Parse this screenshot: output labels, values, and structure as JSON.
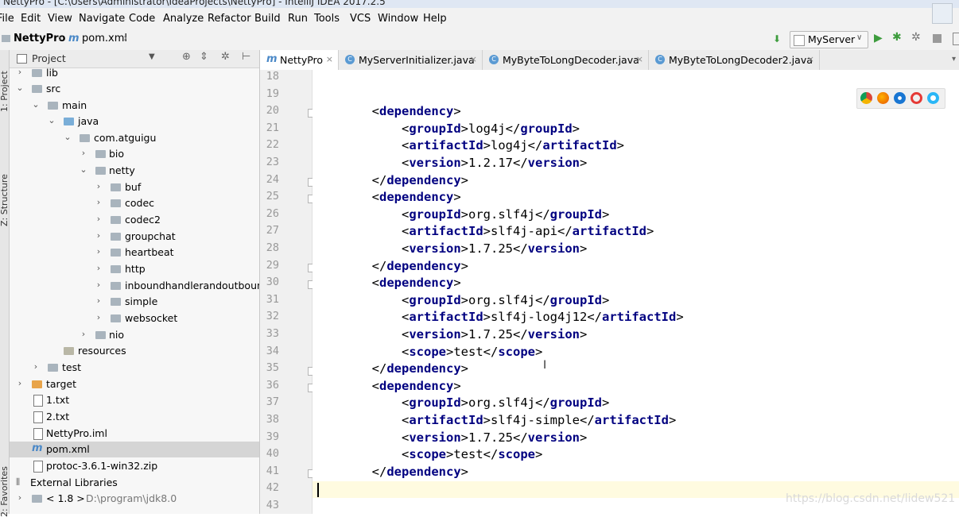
{
  "window_title": "NettyPro - [C:\\Users\\Administrator\\IdeaProjects\\NettyPro] - IntelliJ IDEA 2017.2.5",
  "menu": [
    "File",
    "Edit",
    "View",
    "Navigate",
    "Code",
    "Analyze",
    "Refactor",
    "Build",
    "Run",
    "Tools",
    "VCS",
    "Window",
    "Help"
  ],
  "breadcrumb": {
    "project": "NettyPro",
    "file": "pom.xml"
  },
  "run_config": "MyServer",
  "side_tabs": {
    "project": "1: Project",
    "structure": "Z: Structure",
    "favorites": "2: Favorites"
  },
  "project_panel": {
    "title": "Project",
    "tree": [
      {
        "label": "lib",
        "type": "folder"
      },
      {
        "label": "src",
        "type": "folder"
      },
      {
        "label": "main",
        "type": "folder"
      },
      {
        "label": "java",
        "type": "source-folder"
      },
      {
        "label": "com.atguigu",
        "type": "package"
      },
      {
        "label": "bio",
        "type": "package"
      },
      {
        "label": "netty",
        "type": "package"
      },
      {
        "label": "buf",
        "type": "package"
      },
      {
        "label": "codec",
        "type": "package"
      },
      {
        "label": "codec2",
        "type": "package"
      },
      {
        "label": "groupchat",
        "type": "package"
      },
      {
        "label": "heartbeat",
        "type": "package"
      },
      {
        "label": "http",
        "type": "package"
      },
      {
        "label": "inboundhandlerandoutbound",
        "type": "package"
      },
      {
        "label": "simple",
        "type": "package"
      },
      {
        "label": "websocket",
        "type": "package"
      },
      {
        "label": "nio",
        "type": "package"
      },
      {
        "label": "resources",
        "type": "resources-folder"
      },
      {
        "label": "test",
        "type": "folder"
      },
      {
        "label": "target",
        "type": "excluded-folder"
      },
      {
        "label": "1.txt",
        "type": "file"
      },
      {
        "label": "2.txt",
        "type": "file"
      },
      {
        "label": "NettyPro.iml",
        "type": "file"
      },
      {
        "label": "pom.xml",
        "type": "maven-file",
        "selected": true
      },
      {
        "label": "protoc-3.6.1-win32.zip",
        "type": "file"
      },
      {
        "label": "External Libraries",
        "type": "libraries"
      },
      {
        "label": "< 1.8 >",
        "type": "jdk",
        "path": "D:\\program\\jdk8.0"
      }
    ]
  },
  "tabs": [
    {
      "label": "NettyPro",
      "active": true
    },
    {
      "label": "MyServerInitializer.java",
      "active": false
    },
    {
      "label": "MyByteToLongDecoder.java",
      "active": false
    },
    {
      "label": "MyByteToLongDecoder2.java",
      "active": false
    }
  ],
  "editor": {
    "line_numbers": [
      "18",
      "19",
      "20",
      "21",
      "22",
      "23",
      "24",
      "25",
      "26",
      "27",
      "28",
      "29",
      "30",
      "31",
      "32",
      "33",
      "34",
      "35",
      "36",
      "37",
      "38",
      "39",
      "40",
      "41",
      "42",
      "43"
    ],
    "lines": [
      "",
      "",
      "        <dependency>",
      "            <groupId>log4j</groupId>",
      "            <artifactId>log4j</artifactId>",
      "            <version>1.2.17</version>",
      "        </dependency>",
      "        <dependency>",
      "            <groupId>org.slf4j</groupId>",
      "            <artifactId>slf4j-api</artifactId>",
      "            <version>1.7.25</version>",
      "        </dependency>",
      "        <dependency>",
      "            <groupId>org.slf4j</groupId>",
      "            <artifactId>slf4j-log4j12</artifactId>",
      "            <version>1.7.25</version>",
      "            <scope>test</scope>",
      "        </dependency>",
      "        <dependency>",
      "            <groupId>org.slf4j</groupId>",
      "            <artifactId>slf4j-simple</artifactId>",
      "            <version>1.7.25</version>",
      "            <scope>test</scope>",
      "        </dependency>",
      "",
      ""
    ],
    "current_line": "42"
  },
  "watermark": "https://blog.csdn.net/lidew521",
  "colors": {
    "tag": "#000080",
    "accent": "#4a88c7",
    "run": "#3d9c3d"
  }
}
